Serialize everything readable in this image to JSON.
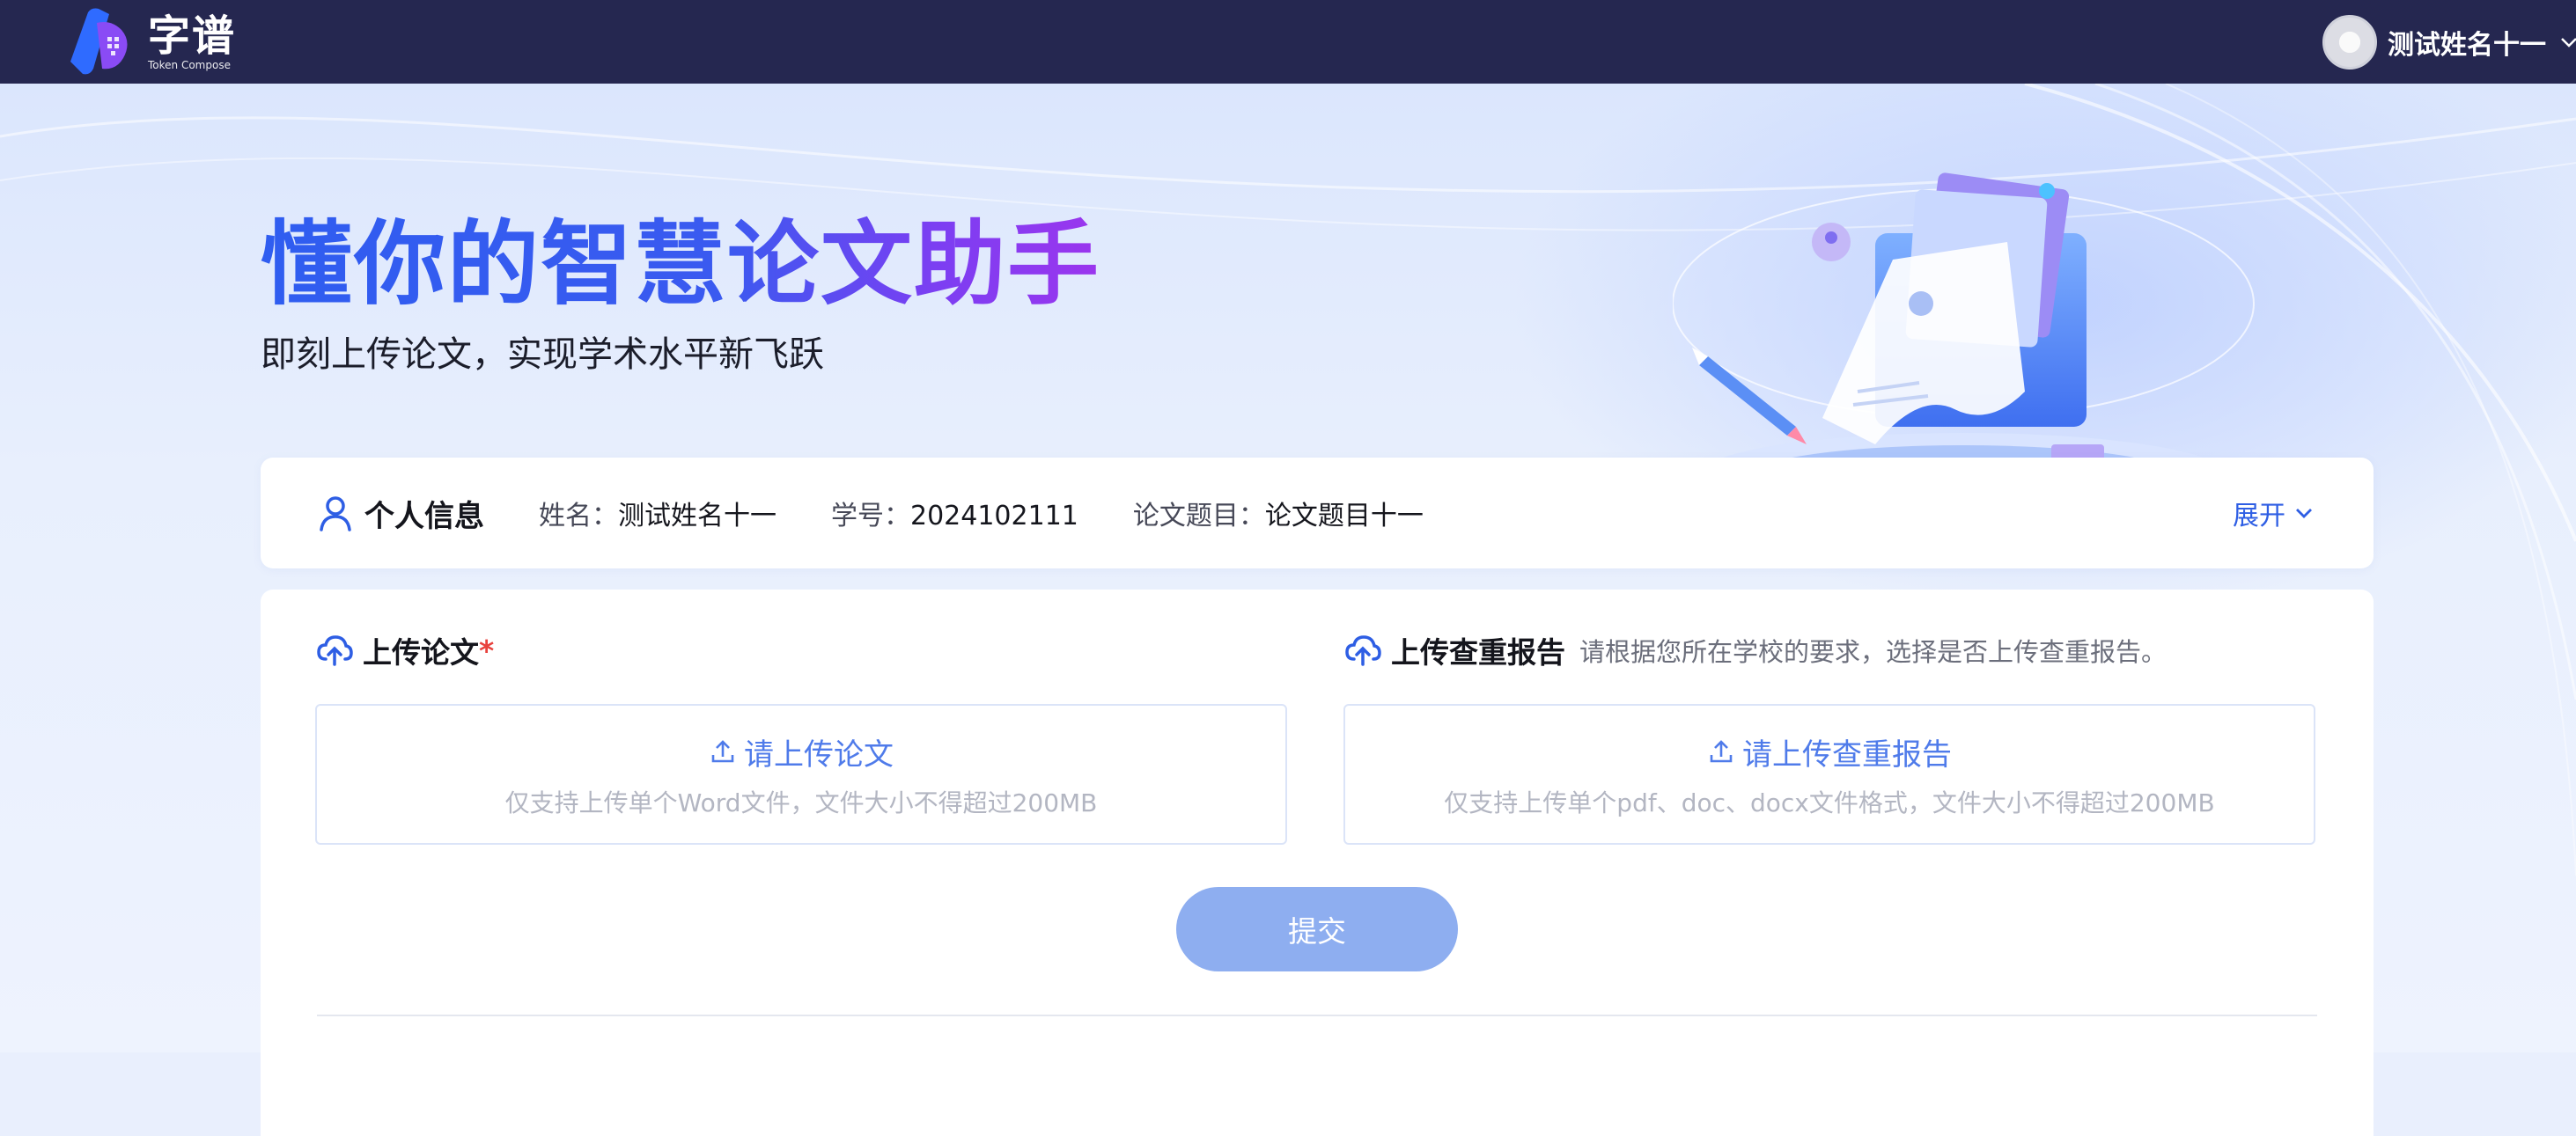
{
  "header": {
    "logo_cn": "字谱",
    "logo_en": "Token Compose",
    "user_name": "测试姓名十一"
  },
  "hero": {
    "headline": "懂你的智慧论文助手",
    "subline": "即刻上传论文，实现学术水平新飞跃"
  },
  "info": {
    "title": "个人信息",
    "fields": [
      {
        "key": "姓名：",
        "value": "测试姓名十一"
      },
      {
        "key": "学号：",
        "value": "2024102111"
      },
      {
        "key": "论文题目：",
        "value": "论文题目十一"
      }
    ],
    "expand_label": "展开"
  },
  "upload_paper": {
    "title": "上传论文",
    "required_mark": "*",
    "button_label": "请上传论文",
    "hint": "仅支持上传单个Word文件，文件大小不得超过200MB"
  },
  "upload_report": {
    "title": "上传查重报告",
    "description": "请根据您所在学校的要求，选择是否上传查重报告。",
    "button_label": "请上传查重报告",
    "hint": "仅支持上传单个pdf、doc、docx文件格式，文件大小不得超过200MB"
  },
  "submit_label": "提交",
  "colors": {
    "topbar": "#252750",
    "accent": "#2e5ee4",
    "submit_disabled": "#8eaef0",
    "required": "#e8423d"
  },
  "icons": {
    "logo": "brand-logo-icon",
    "avatar": "avatar",
    "user_menu": "chevron-down-icon",
    "info": "user-icon",
    "expand": "chevron-down-icon",
    "upload_section": "cloud-upload-icon",
    "upload_button": "upload-icon"
  }
}
